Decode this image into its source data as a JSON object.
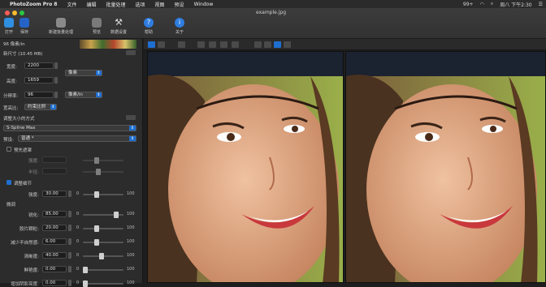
{
  "menubar": {
    "app_name": "PhotoZoom Pro 8",
    "items": [
      "文件",
      "编辑",
      "批量处理",
      "选项",
      "视图",
      "预设",
      "Window"
    ],
    "battery": "99+",
    "clock": "周八 下午2:30"
  },
  "window": {
    "document_title": "example.jpg"
  },
  "toolbar": [
    {
      "label": "打开",
      "icon": "open-folder-icon"
    },
    {
      "label": "保存",
      "icon": "save-icon"
    },
    {
      "label": "新建批量处理",
      "icon": "batch-icon"
    },
    {
      "label": "预览",
      "icon": "preview-icon"
    },
    {
      "label": "数据设置",
      "icon": "tools-icon"
    },
    {
      "label": "帮助",
      "icon": "help-icon"
    },
    {
      "label": "关于",
      "icon": "info-icon"
    }
  ],
  "sidebar": {
    "resolution_caption": "96 像素/in",
    "new_size_label": "新尺寸 (10.45 MB)",
    "width_label": "宽度:",
    "width_value": "2200",
    "height_label": "高度:",
    "height_value": "1659",
    "unit_value": "像素",
    "resolution_label": "分辨率:",
    "resolution_value": "96",
    "resolution_unit": "像素/in",
    "aspect_label": "宽高比:",
    "aspect_value": "约束比例",
    "method_label": "调整大小的方式",
    "method_value": "S-Spline Max",
    "preset_label": "预设:",
    "preset_value": "普通 *",
    "pre_sharpen_label": "预先遮罩",
    "strength_label": "强度:",
    "tolerance_label": "半径:",
    "sharpen_label": "调整细节",
    "sharpen_strength_label": "强度:",
    "sharpen_strength_value": "30.00",
    "processing_label": "微调",
    "slider_min": "0",
    "slider_max": "100",
    "rows": [
      {
        "label": "锐化:",
        "value": "85.00"
      },
      {
        "label": "胶片颗粒:",
        "value": "20.00"
      },
      {
        "label": "减少不自然感:",
        "value": "6.00"
      },
      {
        "label": "清晰度:",
        "value": "40.00"
      },
      {
        "label": "鲜艳度:",
        "value": "0.00"
      },
      {
        "label": "增加阴影亮度:",
        "value": "0.00"
      }
    ]
  },
  "colors": {
    "accent": "#1f6fd1",
    "panel": "#2c2c2c"
  }
}
